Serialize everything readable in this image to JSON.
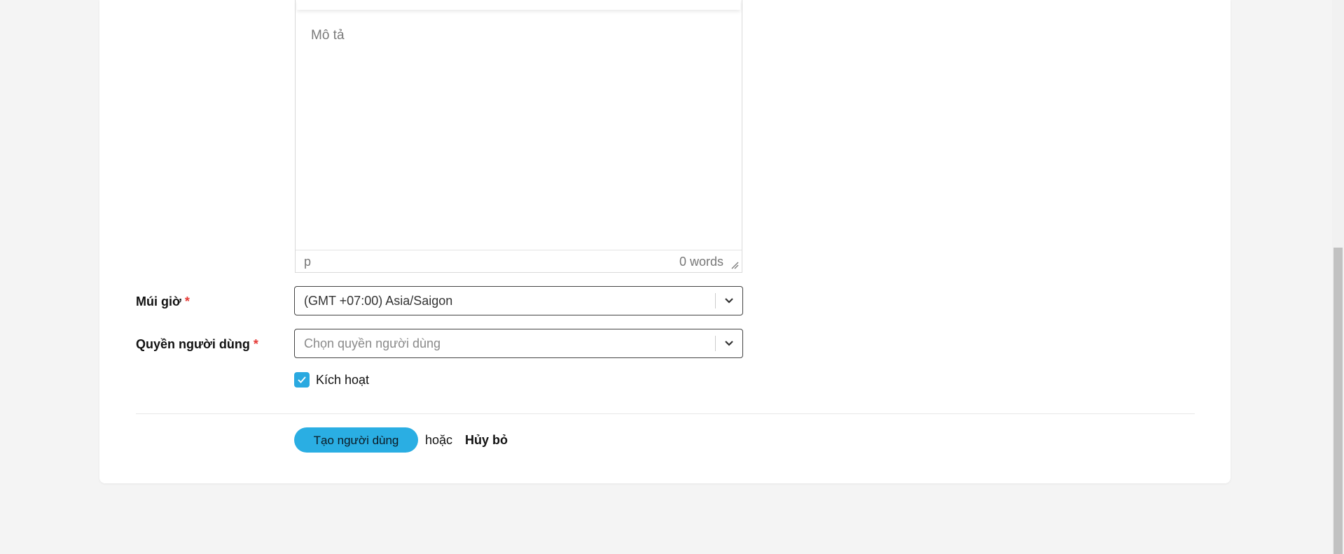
{
  "editor": {
    "placeholder": "Mô tả",
    "path": "p",
    "word_count": "0 words"
  },
  "timezone": {
    "label": "Múi giờ",
    "required_mark": "*",
    "value": "(GMT +07:00) Asia/Saigon"
  },
  "role": {
    "label": "Quyền người dùng",
    "required_mark": "*",
    "placeholder": "Chọn quyền người dùng"
  },
  "active": {
    "label": "Kích hoạt",
    "checked": true
  },
  "actions": {
    "create_label": "Tạo người dùng",
    "or_text": "hoặc",
    "cancel_label": "Hủy bỏ"
  },
  "colors": {
    "accent": "#2aaee3",
    "required": "#e53935"
  }
}
